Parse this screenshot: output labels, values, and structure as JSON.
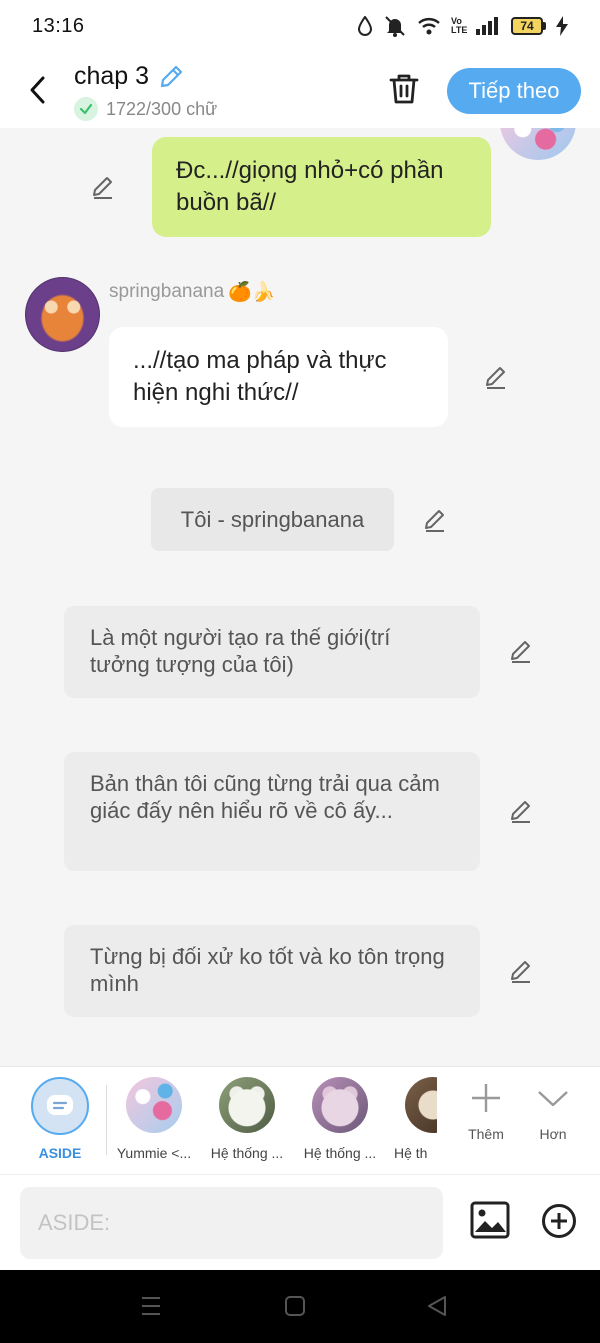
{
  "status_bar": {
    "time": "13:16",
    "battery_level": "74",
    "network_label": "Vo LTE"
  },
  "header": {
    "title": "chap 3",
    "word_count": "1722/300 chữ",
    "next_label": "Tiếp theo"
  },
  "messages": [
    {
      "type": "bubble-right",
      "text": "Đc...//giọng nhỏ+có phần buồn bã//"
    },
    {
      "type": "sender",
      "name": "springbanana",
      "emoji": "🍊🍌"
    },
    {
      "type": "bubble-left",
      "text": "...//tạo ma pháp và thực hiện nghi thức//"
    },
    {
      "type": "pill",
      "text": "Tôi - springbanana"
    },
    {
      "type": "narration",
      "text": "Là một người tạo ra thế giới(trí tưởng tượng của tôi)"
    },
    {
      "type": "narration",
      "text": "Bản thân tôi cũng từng trải qua cảm giác đấy nên hiểu rõ về cô ấy..."
    },
    {
      "type": "narration",
      "text": "Từng bị đối xử ko tốt và ko tôn trọng mình"
    }
  ],
  "characters": [
    {
      "name": "ASIDE",
      "active": true
    },
    {
      "name": "Yummie <..."
    },
    {
      "name": "Hệ thống ..."
    },
    {
      "name": "Hệ thống ..."
    },
    {
      "name": "Hệ th"
    }
  ],
  "actions": {
    "add_label": "Thêm",
    "more_label": "Hơn"
  },
  "input": {
    "placeholder": "ASIDE:"
  },
  "colors": {
    "accent": "#56aaf0",
    "green_bubble": "#d5ef8b",
    "background": "#f5f5f5"
  }
}
